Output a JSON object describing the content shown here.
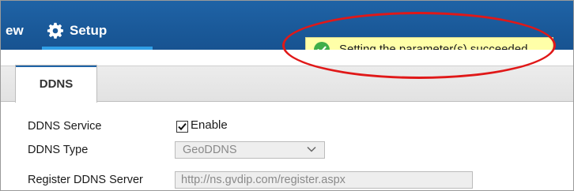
{
  "nav": {
    "partial_item": "ew",
    "setup_label": "Setup"
  },
  "toast": {
    "message": "Setting the parameter(s) succeeded."
  },
  "tabs": [
    {
      "label": "DDNS"
    }
  ],
  "form": {
    "ddns_service": {
      "label": "DDNS Service",
      "checkbox_label": "Enable",
      "checked": true
    },
    "ddns_type": {
      "label": "DDNS Type",
      "value": "GeoDDNS"
    },
    "register_server": {
      "label": "Register DDNS Server",
      "value": "http://ns.gvdip.com/register.aspx"
    }
  },
  "colors": {
    "nav_bg": "#1a5999",
    "nav_accent": "#2f9ee6",
    "toast_bg": "#ffffa8",
    "success": "#3fae49",
    "annotation_ring": "#e01818"
  }
}
